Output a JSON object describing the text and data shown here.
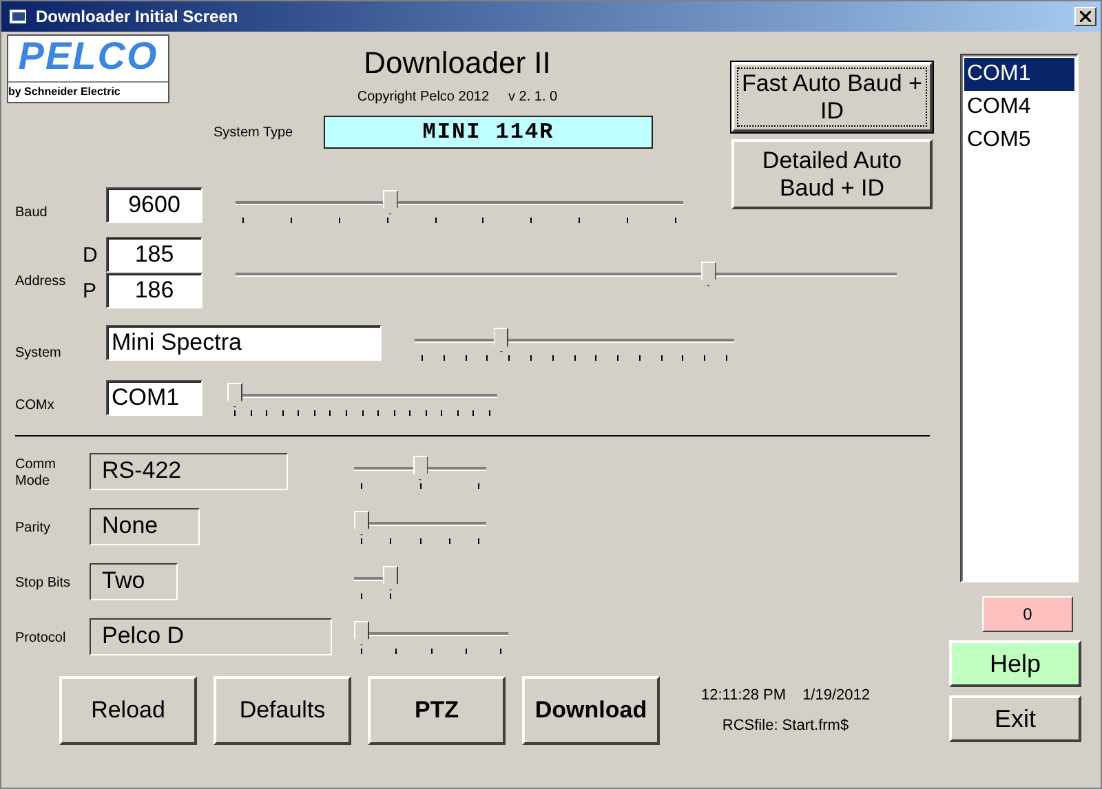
{
  "window": {
    "title": "Downloader Initial Screen"
  },
  "logo": {
    "brand": "PELCO",
    "tagline": "by Schneider Electric"
  },
  "header": {
    "title": "Downloader II",
    "copyright": "Copyright Pelco 2012",
    "version": "v 2. 1. 0"
  },
  "system_type": {
    "label": "System Type",
    "value": "MINI 114R"
  },
  "auto_buttons": [
    {
      "label": "Fast Auto Baud + ID",
      "focused": true
    },
    {
      "label": "Detailed Auto Baud + ID",
      "focused": false
    }
  ],
  "settings": [
    {
      "label": "Baud",
      "fields": [
        {
          "value": "9600"
        }
      ],
      "level": 0.34
    },
    {
      "label": "Address",
      "fields": [
        {
          "prefix": "D",
          "value": "185"
        },
        {
          "prefix": "P",
          "value": "186"
        }
      ],
      "level": 0.72
    },
    {
      "label": "System",
      "fields": [
        {
          "value": "Mini Spectra"
        }
      ],
      "level": 0.26
    },
    {
      "label": "COMx",
      "fields": [
        {
          "value": "COM1"
        }
      ],
      "level": 0
    }
  ],
  "comm_settings": [
    {
      "label": "Comm Mode",
      "value": "RS-422",
      "level": 0.5
    },
    {
      "label": "Parity",
      "value": "None",
      "level": 0
    },
    {
      "label": "Stop Bits",
      "value": "Two",
      "level": 1
    },
    {
      "label": "Protocol",
      "value": "Pelco D",
      "level": 0
    }
  ],
  "actions": [
    {
      "label": "Reload",
      "bold": false
    },
    {
      "label": "Defaults",
      "bold": false
    },
    {
      "label": "PTZ",
      "bold": true
    },
    {
      "label": "Download",
      "bold": true
    }
  ],
  "status": {
    "time": "12:11:28 PM",
    "date": "1/19/2012",
    "rcs_file": "RCSfile: Start.frm$"
  },
  "com_ports": [
    {
      "label": "COM1",
      "selected": true
    },
    {
      "label": "COM4",
      "selected": false
    },
    {
      "label": "COM5",
      "selected": false
    }
  ],
  "counter": "0",
  "side_buttons": {
    "help": "Help",
    "exit": "Exit"
  }
}
